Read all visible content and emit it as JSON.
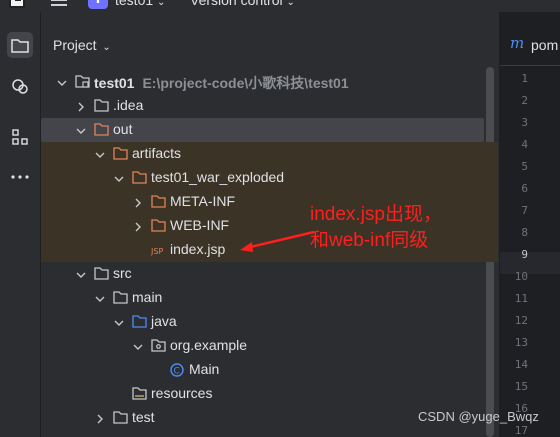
{
  "topbar": {
    "project_badge": "T",
    "project_name": "test01",
    "vcs_label": "Version control"
  },
  "panel": {
    "title": "Project"
  },
  "tree": [
    {
      "label": "test01",
      "hint": "E:\\project-code\\小歌科技\\test01",
      "depth": 0,
      "expanded": true,
      "kind": "module",
      "bold": true
    },
    {
      "label": ".idea",
      "depth": 1,
      "expanded": false,
      "kind": "folder"
    },
    {
      "label": "out",
      "depth": 1,
      "expanded": true,
      "kind": "folder-orange",
      "selected": true
    },
    {
      "label": "artifacts",
      "depth": 2,
      "expanded": true,
      "kind": "folder-orange"
    },
    {
      "label": "test01_war_exploded",
      "depth": 3,
      "expanded": true,
      "kind": "folder-orange"
    },
    {
      "label": "META-INF",
      "depth": 4,
      "expanded": false,
      "kind": "folder-orange"
    },
    {
      "label": "WEB-INF",
      "depth": 4,
      "expanded": false,
      "kind": "folder-orange"
    },
    {
      "label": "index.jsp",
      "depth": 4,
      "kind": "jsp",
      "leaf": true
    },
    {
      "label": "src",
      "depth": 1,
      "expanded": true,
      "kind": "folder"
    },
    {
      "label": "main",
      "depth": 2,
      "expanded": true,
      "kind": "folder"
    },
    {
      "label": "java",
      "depth": 3,
      "expanded": true,
      "kind": "folder-blue"
    },
    {
      "label": "org.example",
      "depth": 4,
      "expanded": true,
      "kind": "package"
    },
    {
      "label": "Main",
      "depth": 5,
      "kind": "class",
      "leaf": true
    },
    {
      "label": "resources",
      "depth": 3,
      "kind": "folder-res",
      "leaf": true
    },
    {
      "label": "test",
      "depth": 2,
      "expanded": false,
      "kind": "folder"
    }
  ],
  "editor": {
    "tab_icon": "m",
    "tab_label": "pom",
    "line_numbers": [
      "1",
      "2",
      "3",
      "4",
      "5",
      "6",
      "7",
      "8",
      "9",
      "10",
      "11",
      "12",
      "13",
      "14",
      "15",
      "16",
      "17"
    ],
    "current_line": "9"
  },
  "annotation": {
    "line1": "index.jsp出现，",
    "line2": "和web-inf同级"
  },
  "watermark": "CSDN @yuge_Bwqz",
  "colors": {
    "background": "#2b2d30",
    "editor_bg": "#1e1f22",
    "selection": "#43454a",
    "out_highlight": "#3b3325",
    "annotation_red": "#ff1f1f",
    "accent_blue": "#4f8df6"
  }
}
